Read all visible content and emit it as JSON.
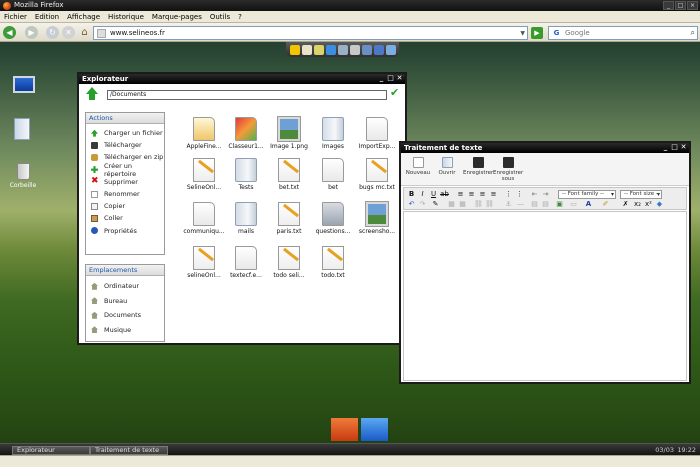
{
  "browser": {
    "title": "Mozilla Firefox",
    "menu": [
      "Fichier",
      "Edition",
      "Affichage",
      "Historique",
      "Marque-pages",
      "Outils",
      "?"
    ],
    "url": "www.selineos.fr",
    "search_placeholder": "Google"
  },
  "explorer": {
    "title": "Explorateur",
    "path": "/Documents",
    "actions_title": "Actions",
    "actions": [
      "Charger un fichier",
      "Télécharger",
      "Télécharger en zip",
      "Créer un répertoire",
      "Supprimer",
      "Renommer",
      "Copier",
      "Coller",
      "Propriétés"
    ],
    "places_title": "Emplacements",
    "places": [
      "Ordinateur",
      "Bureau",
      "Documents",
      "Musique"
    ],
    "files": [
      {
        "name": "AppleFine...",
        "kind": "notes"
      },
      {
        "name": "Classeur1...",
        "kind": "sheet"
      },
      {
        "name": "Image 1.png",
        "kind": "image"
      },
      {
        "name": "Images",
        "kind": "folder"
      },
      {
        "name": "ImportExp...",
        "kind": "doc"
      },
      {
        "name": "SelineOnl...",
        "kind": "txt"
      },
      {
        "name": "Tests",
        "kind": "folder"
      },
      {
        "name": "bet.txt",
        "kind": "txt"
      },
      {
        "name": "bet",
        "kind": "doc"
      },
      {
        "name": "bugs mc.txt",
        "kind": "txt"
      },
      {
        "name": "communiqu...",
        "kind": "doc"
      },
      {
        "name": "mails",
        "kind": "folder"
      },
      {
        "name": "paris.txt",
        "kind": "txt"
      },
      {
        "name": "questions...",
        "kind": "app"
      },
      {
        "name": "screensho...",
        "kind": "image"
      },
      {
        "name": "selineOnl...",
        "kind": "txt"
      },
      {
        "name": "textecf.e...",
        "kind": "doc"
      },
      {
        "name": "todo seli...",
        "kind": "txt"
      },
      {
        "name": "todo.txt",
        "kind": "txt"
      }
    ]
  },
  "editor": {
    "title": "Traitement de texte",
    "toolbar": [
      "Nouveau",
      "Ouvrir",
      "Enregistrer",
      "Enregistrer sous"
    ],
    "font_family": "-- Font family --",
    "font_size": "-- Font size --"
  },
  "desktop": {
    "trash_label": "Corbeille"
  },
  "taskbar": {
    "tasks": [
      "Explorateur",
      "Traitement de texte"
    ],
    "date": "03/03",
    "time": "19:22"
  },
  "colors": {
    "accent_green": "#27a02a",
    "link_blue": "#1b56a6",
    "window_title": "#000000"
  }
}
